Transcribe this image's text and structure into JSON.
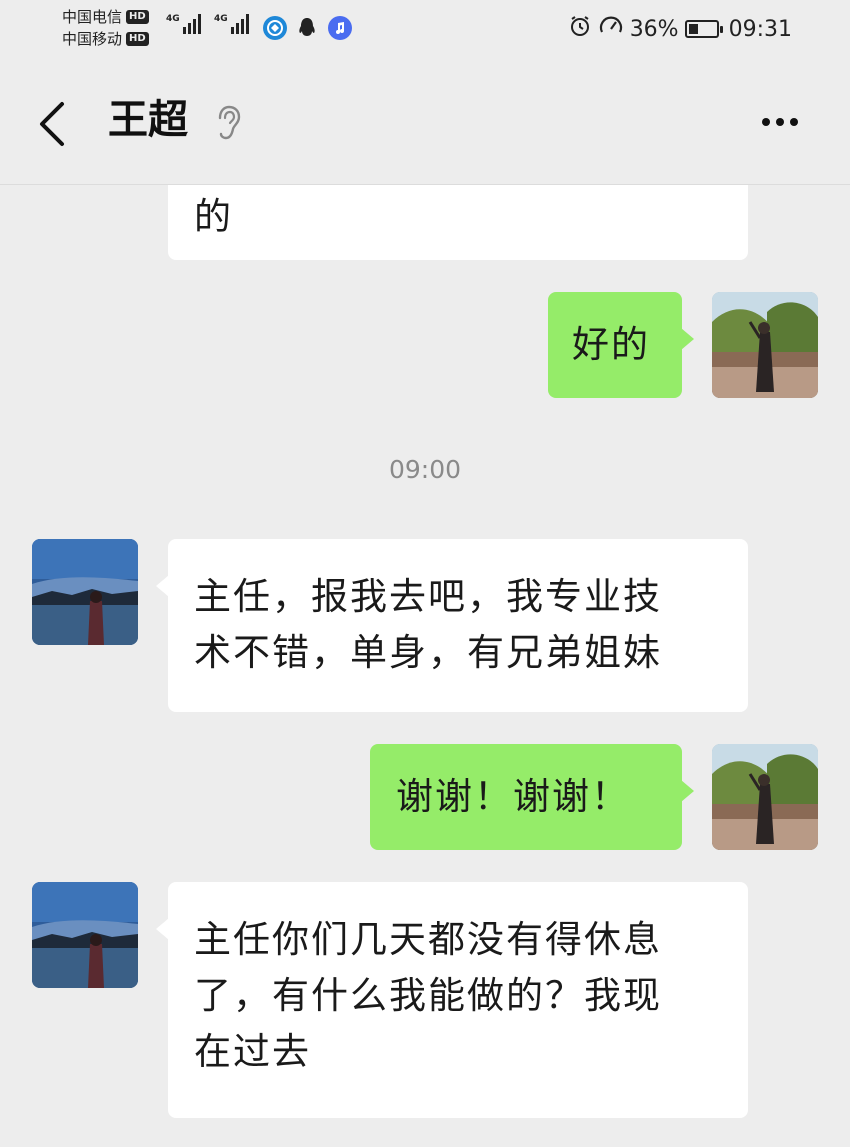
{
  "status_bar": {
    "carrier_1": "中国电信",
    "carrier_2": "中国移动",
    "hd_label": "HD",
    "network_1": "4G",
    "network_2": "4G",
    "battery_percent": "36%",
    "battery_level": 0.36,
    "time": "09:31"
  },
  "header": {
    "title": "王超"
  },
  "messages": [
    {
      "side": "incoming",
      "text": "的"
    },
    {
      "side": "outgoing",
      "text": "好的"
    },
    {
      "type": "timestamp",
      "text": "09:00"
    },
    {
      "side": "incoming",
      "lines": [
        "主任，报我去吧，我专业技",
        "术不错，单身，有兄弟姐妹"
      ]
    },
    {
      "side": "outgoing",
      "text": "谢谢！谢谢！"
    },
    {
      "side": "incoming",
      "lines": [
        "主任你们几天都没有得休息",
        "了，有什么我能做的？我现",
        "在过去"
      ]
    }
  ],
  "colors": {
    "background": "#ededed",
    "outgoing_bubble": "#95ec69",
    "incoming_bubble": "#ffffff"
  }
}
